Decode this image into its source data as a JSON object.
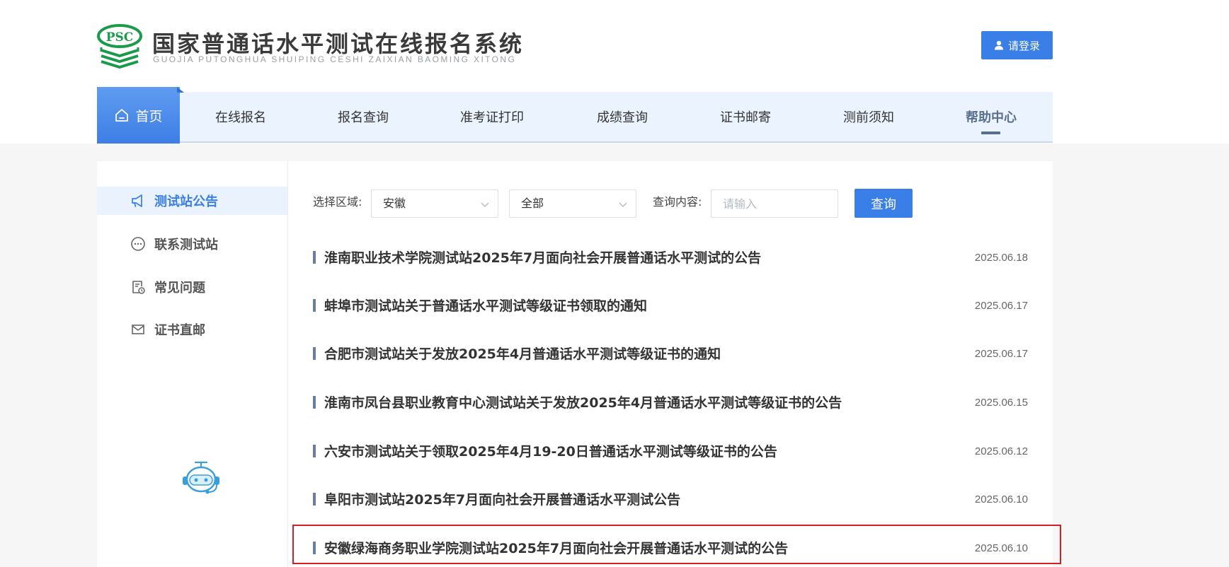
{
  "header": {
    "logo_badge": "PSC",
    "title": "国家普通话水平测试在线报名系统",
    "subtitle": "GUOJIA PUTONGHUA SHUIPING CESHI ZAIXIAN BAOMING XITONG",
    "login_label": "请登录"
  },
  "nav": {
    "home": "首页",
    "items": [
      "在线报名",
      "报名查询",
      "准考证打印",
      "成绩查询",
      "证书邮寄",
      "测前须知",
      "帮助中心"
    ],
    "active": "帮助中心"
  },
  "sidebar": {
    "items": [
      {
        "label": "测试站公告",
        "icon": "megaphone-icon",
        "active": true
      },
      {
        "label": "联系测试站",
        "icon": "chat-bubble-icon",
        "active": false
      },
      {
        "label": "常见问题",
        "icon": "document-clock-icon",
        "active": false
      },
      {
        "label": "证书直邮",
        "icon": "envelope-icon",
        "active": false
      }
    ],
    "assistant_icon": "robot-assistant-icon"
  },
  "filters": {
    "region_label": "选择区域:",
    "region_value": "安徽",
    "category_value": "全部",
    "query_label": "查询内容:",
    "query_placeholder": "请输入",
    "query_button": "查询"
  },
  "announcements": [
    {
      "title": "淮南职业技术学院测试站2025年7月面向社会开展普通话水平测试的公告",
      "date": "2025.06.18"
    },
    {
      "title": "蚌埠市测试站关于普通话水平测试等级证书领取的通知",
      "date": "2025.06.17"
    },
    {
      "title": "合肥市测试站关于发放2025年4月普通话水平测试等级证书的通知",
      "date": "2025.06.17"
    },
    {
      "title": "淮南市凤台县职业教育中心测试站关于发放2025年4月普通话水平测试等级证书的公告",
      "date": "2025.06.15"
    },
    {
      "title": "六安市测试站关于领取2025年4月19-20日普通话水平测试等级证书的公告",
      "date": "2025.06.12"
    },
    {
      "title": "阜阳市测试站2025年7月面向社会开展普通话水平测试公告",
      "date": "2025.06.10"
    },
    {
      "title": "安徽绿海商务职业学院测试站2025年7月面向社会开展普通话水平测试的公告",
      "date": "2025.06.10"
    }
  ],
  "colors": {
    "accent": "#3a7ee8",
    "nav_bg": "#ebf3fe",
    "highlight": "#d21f26",
    "logo_green": "#1a9a4a"
  }
}
